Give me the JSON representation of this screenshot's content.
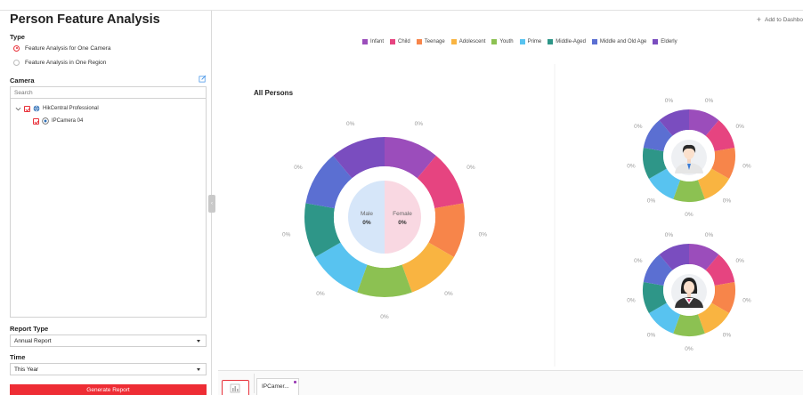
{
  "title": "Person Feature Analysis",
  "type_section": {
    "label": "Type",
    "options": [
      {
        "label": "Feature Analysis for One Camera",
        "selected": true
      },
      {
        "label": "Feature Analysis in One Region",
        "selected": false
      }
    ]
  },
  "camera_section": {
    "label": "Camera",
    "search_placeholder": "Search",
    "tree": [
      {
        "label": "HikCentral Professional",
        "level": 0,
        "checked": true,
        "icon": "site-icon"
      },
      {
        "label": "IPCamera 04",
        "level": 1,
        "checked": true,
        "icon": "camera-icon"
      }
    ]
  },
  "report_type": {
    "label": "Report Type",
    "value": "Annual Report"
  },
  "time": {
    "label": "Time",
    "value": "This Year"
  },
  "generate_button": "Generate Report",
  "add_to_dashboard": "Add to Dashbo",
  "legend": [
    {
      "label": "Infant",
      "color": "#9b4dbb"
    },
    {
      "label": "Child",
      "color": "#e64480"
    },
    {
      "label": "Teenage",
      "color": "#f7854a"
    },
    {
      "label": "Adolescent",
      "color": "#f9b441"
    },
    {
      "label": "Youth",
      "color": "#8cc152"
    },
    {
      "label": "Prime",
      "color": "#58c3f0"
    },
    {
      "label": "Middle-Aged",
      "color": "#2e9688"
    },
    {
      "label": "Middle and Old Age",
      "color": "#5b6fd2"
    },
    {
      "label": "Elderly",
      "color": "#7a4dbf"
    }
  ],
  "all_persons_label": "All Persons",
  "main_chart": {
    "percent_labels": [
      "0%",
      "0%",
      "0%",
      "0%",
      "0%",
      "0%",
      "0%",
      "0%",
      "0%"
    ],
    "male": {
      "label": "Male",
      "value": "0%",
      "color": "#d6e6f9"
    },
    "female": {
      "label": "Female",
      "value": "0%",
      "color": "#f9d8e2"
    }
  },
  "male_chart": {
    "percent_labels": [
      "0%",
      "0%",
      "0%",
      "0%",
      "0%",
      "0%",
      "0%",
      "0%",
      "0%"
    ],
    "icon": "male-avatar-icon"
  },
  "female_chart": {
    "percent_labels": [
      "0%",
      "0%",
      "0%",
      "0%",
      "0%",
      "0%",
      "0%",
      "0%",
      "0%"
    ],
    "icon": "female-avatar-icon"
  },
  "bottom_tabs": [
    {
      "label": "IPCamer..."
    }
  ]
}
